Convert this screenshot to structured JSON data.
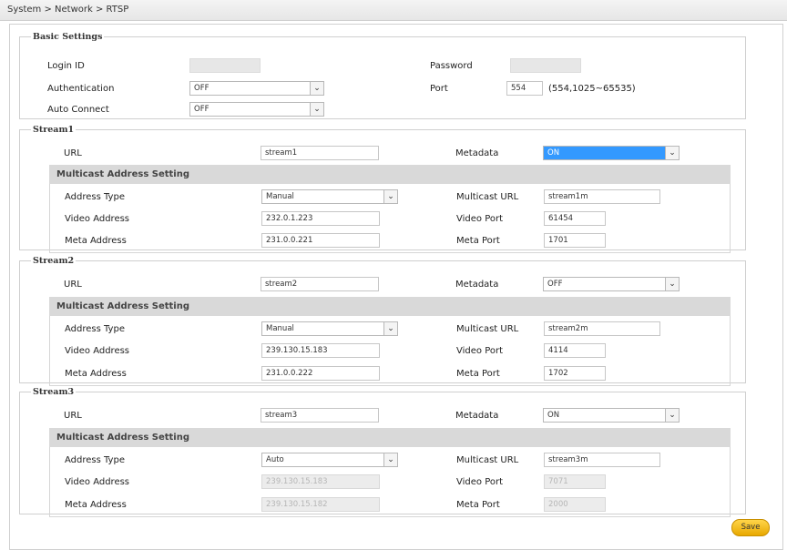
{
  "breadcrumb": "System > Network > RTSP",
  "basic": {
    "legend": "Basic Settings",
    "login_id_label": "Login ID",
    "login_id_value": "",
    "password_label": "Password",
    "password_value": "",
    "auth_label": "Authentication",
    "auth_value": "OFF",
    "port_label": "Port",
    "port_value": "554",
    "port_hint": "(554,1025~65535)",
    "auto_connect_label": "Auto Connect",
    "auto_connect_value": "OFF"
  },
  "labels": {
    "url": "URL",
    "metadata": "Metadata",
    "multicast_setting": "Multicast Address Setting",
    "address_type": "Address Type",
    "multicast_url": "Multicast URL",
    "video_address": "Video Address",
    "video_port": "Video Port",
    "meta_address": "Meta Address",
    "meta_port": "Meta Port"
  },
  "streams": [
    {
      "legend": "Stream1",
      "url": "stream1",
      "metadata": "ON",
      "address_type": "Manual",
      "multicast_url": "stream1m",
      "video_address": "232.0.1.223",
      "video_port": "61454",
      "meta_address": "231.0.0.221",
      "meta_port": "1701"
    },
    {
      "legend": "Stream2",
      "url": "stream2",
      "metadata": "OFF",
      "address_type": "Manual",
      "multicast_url": "stream2m",
      "video_address": "239.130.15.183",
      "video_port": "4114",
      "meta_address": "231.0.0.222",
      "meta_port": "1702"
    },
    {
      "legend": "Stream3",
      "url": "stream3",
      "metadata": "ON",
      "address_type": "Auto",
      "multicast_url": "stream3m",
      "video_address": "239.130.15.183",
      "video_port": "7071",
      "meta_address": "239.130.15.182",
      "meta_port": "2000"
    }
  ],
  "save_label": "Save",
  "colors": {
    "highlight": "#3399ff",
    "save_button": "#f0b400",
    "section_bar": "#d9d9d9"
  }
}
